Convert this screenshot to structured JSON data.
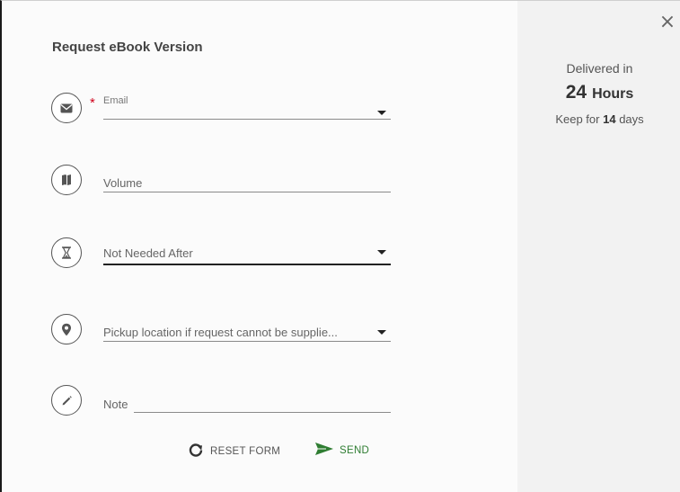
{
  "dialog": {
    "title": "Request eBook Version",
    "close_label": "×"
  },
  "side": {
    "delivered_label": "Delivered in",
    "hours_value": "24",
    "hours_label": "Hours",
    "keep_prefix": "Keep for",
    "keep_value": "14",
    "keep_suffix": "days"
  },
  "form": {
    "email": {
      "label": "Email",
      "value": "",
      "required_mark": "*",
      "icon": "envelope-icon"
    },
    "volume": {
      "placeholder": "Volume",
      "value": "",
      "icon": "book-icon"
    },
    "not_needed_after": {
      "placeholder": "Not Needed After",
      "icon": "hourglass-icon"
    },
    "pickup_location": {
      "placeholder": "Pickup location if request cannot be supplie...",
      "icon": "location-pin-icon"
    },
    "note": {
      "placeholder": "Note",
      "value": "",
      "icon": "pencil-icon"
    }
  },
  "actions": {
    "reset_label": "RESET FORM",
    "send_label": "SEND"
  },
  "colors": {
    "accent_send": "#2f7d32",
    "required": "#d0021b",
    "side_background": "#f2f2f2"
  }
}
